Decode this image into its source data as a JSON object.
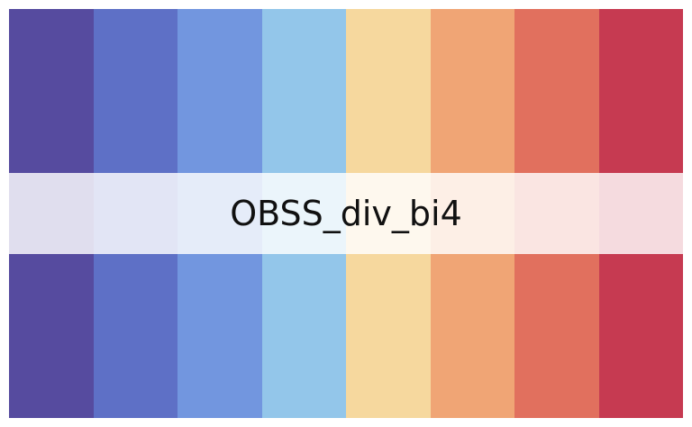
{
  "palette": {
    "name": "OBSS_div_bi4",
    "colors": [
      "#564b9f",
      "#5e70c6",
      "#7296df",
      "#93c6ea",
      "#f6d89e",
      "#f0a575",
      "#e1705e",
      "#c63a51"
    ]
  }
}
